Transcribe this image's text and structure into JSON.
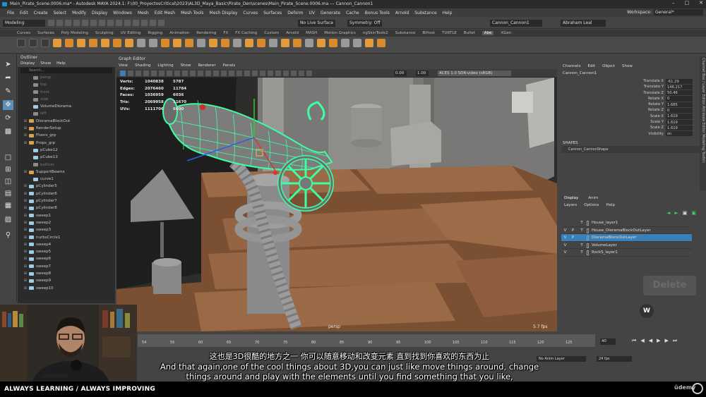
{
  "window": {
    "title": "Main_Pirate_Scene.0006.ma* - Autodesk MAYA 2024.1: F:\\00_ProyectosCritical\\2023\\AL3D_Maya_Basic\\Pirate_Den\\scenes\\Main_Pirate_Scene.0006.ma   ---   Cannon_Cannon1"
  },
  "menu": [
    "File",
    "Edit",
    "Create",
    "Select",
    "Modify",
    "Display",
    "Windows",
    "Mesh",
    "Edit Mesh",
    "Mesh Tools",
    "Mesh Display",
    "Curves",
    "Surfaces",
    "Deform",
    "UV",
    "Generate",
    "Cache",
    "Bonus Tools",
    "Arnold",
    "Substance",
    "Help"
  ],
  "workspace": {
    "label": "Workspace:",
    "value": "General*"
  },
  "status": {
    "mode": "Modeling",
    "live_surface": "No Live Surface",
    "symmetry": "Symmetry: Off",
    "object": "Cannon_Cannon1",
    "user": "Abraham Leal"
  },
  "shelf_tabs": [
    "Curves",
    "Surfaces",
    "Poly Modeling",
    "Sculpting",
    "UV Editing",
    "Rigging",
    "Animation",
    "Rendering",
    "FX",
    "FX Caching",
    "Custom",
    "Arnold",
    "MASH",
    "Motion Graphics",
    "ngSkinTools2",
    "Substance",
    "Bifrost",
    "TURTLE",
    "Bullet",
    "Abe",
    "XGen"
  ],
  "shelf_active": "Abe",
  "outliner": {
    "title": "Outliner",
    "menu": [
      "Display",
      "Show",
      "Help"
    ],
    "search_placeholder": "Search...",
    "items": [
      "persp",
      "top",
      "front",
      "side",
      "VolumeDiorama",
      "left",
      "DioramaBlockOut",
      "RenderSetup",
      "Floors_grp",
      "Props_grp",
      "pCube12",
      "pCube13",
      "bottom",
      "SupportBeams",
      "curve1",
      "pCylinder5",
      "pCylinder6",
      "pCylinder7",
      "pCylinder8",
      "sweep1",
      "sweep2",
      "sweep3",
      "nurbsCircle1",
      "sweep4",
      "sweep5",
      "sweep6",
      "sweep7",
      "sweep8",
      "sweep9",
      "sweep10"
    ]
  },
  "graph": {
    "title": "Graph Editor",
    "menu": [
      "View",
      "Shading",
      "Lighting",
      "Show",
      "Renderer",
      "Panels"
    ],
    "exposure": "0.00",
    "gamma": "1.00",
    "colorspace": "ACES 1.0 SDR-video (sRGB)"
  },
  "hud": [
    {
      "k": "Verts:",
      "a": "1040838",
      "b": "5787"
    },
    {
      "k": "Edges:",
      "a": "2076460",
      "b": "11784"
    },
    {
      "k": "Faces:",
      "a": "1036959",
      "b": "6036"
    },
    {
      "k": "Tris:",
      "a": "2069958",
      "b": "11670"
    },
    {
      "k": "UVs:",
      "a": "1111706",
      "b": "6600"
    }
  ],
  "viewport": {
    "camera": "persp",
    "fps": "5.7 fps"
  },
  "channel_box": {
    "menu": [
      "Channels",
      "Edit",
      "Object",
      "Show"
    ],
    "object": "Cannon_Cannon1",
    "attrs": [
      {
        "k": "Translate X",
        "v": "-61.29"
      },
      {
        "k": "Translate Y",
        "v": "146.217"
      },
      {
        "k": "Translate Z",
        "v": "50.46"
      },
      {
        "k": "Rotate X",
        "v": "0"
      },
      {
        "k": "Rotate Y",
        "v": "1.685"
      },
      {
        "k": "Rotate Z",
        "v": "0"
      },
      {
        "k": "Scale X",
        "v": "1.619"
      },
      {
        "k": "Scale Y",
        "v": "1.619"
      },
      {
        "k": "Scale Z",
        "v": "1.619"
      },
      {
        "k": "Visibility",
        "v": "on"
      }
    ],
    "shapes_label": "SHAPES",
    "shape": "Cannon_CannonShape",
    "side_tabs": "Channel Box / Layer Editor     Attribute Editor     Modeling Toolkit"
  },
  "layers": {
    "tabs": [
      "Display",
      "Anim"
    ],
    "menu": [
      "Layers",
      "Options",
      "Help"
    ],
    "rows": [
      {
        "v": "",
        "p": "",
        "t": "T",
        "name": "House_layer1",
        "color": "#444"
      },
      {
        "v": "V",
        "p": "P",
        "t": "T",
        "name": "House_DioramaBlockOutLayer",
        "color": "#444"
      },
      {
        "v": "V",
        "p": "P",
        "t": "",
        "name": "DioramaBlockOutLayer",
        "color": "#3a7fb5"
      },
      {
        "v": "V",
        "p": "",
        "t": "T",
        "name": "VolumeLayer",
        "color": "#444"
      },
      {
        "v": "V",
        "p": "",
        "t": "T",
        "name": "RockS_layer1",
        "color": "#444"
      }
    ],
    "delete_label": "Delete",
    "w_label": "W"
  },
  "timeline": {
    "ticks": [
      "54",
      "55",
      "60",
      "65",
      "70",
      "75",
      "80",
      "85",
      "90",
      "95",
      "100",
      "105",
      "110",
      "115",
      "120",
      "125"
    ],
    "frame": "40",
    "anim_layer": "No Anim Layer",
    "fps": "24 fps"
  },
  "subtitles": {
    "zh": "这也是3D很酷的地方之一 你可以随意移动和改变元素 直到找到你喜欢的东西为止",
    "en1": "And that again,one of the cool things about 3D,you can just like move things around, change",
    "en2": "things around and play with the elements until you find something that you like,"
  },
  "footer": {
    "slogan": "ALWAYS LEARNING / ALWAYS IMPROVING",
    "brand": "ûdemy"
  },
  "colors": {
    "accent": "#1d8fd6",
    "selection": "#3dffa2",
    "wood": "#8a5a3c",
    "gray_mesh": "#8c8c8c"
  }
}
